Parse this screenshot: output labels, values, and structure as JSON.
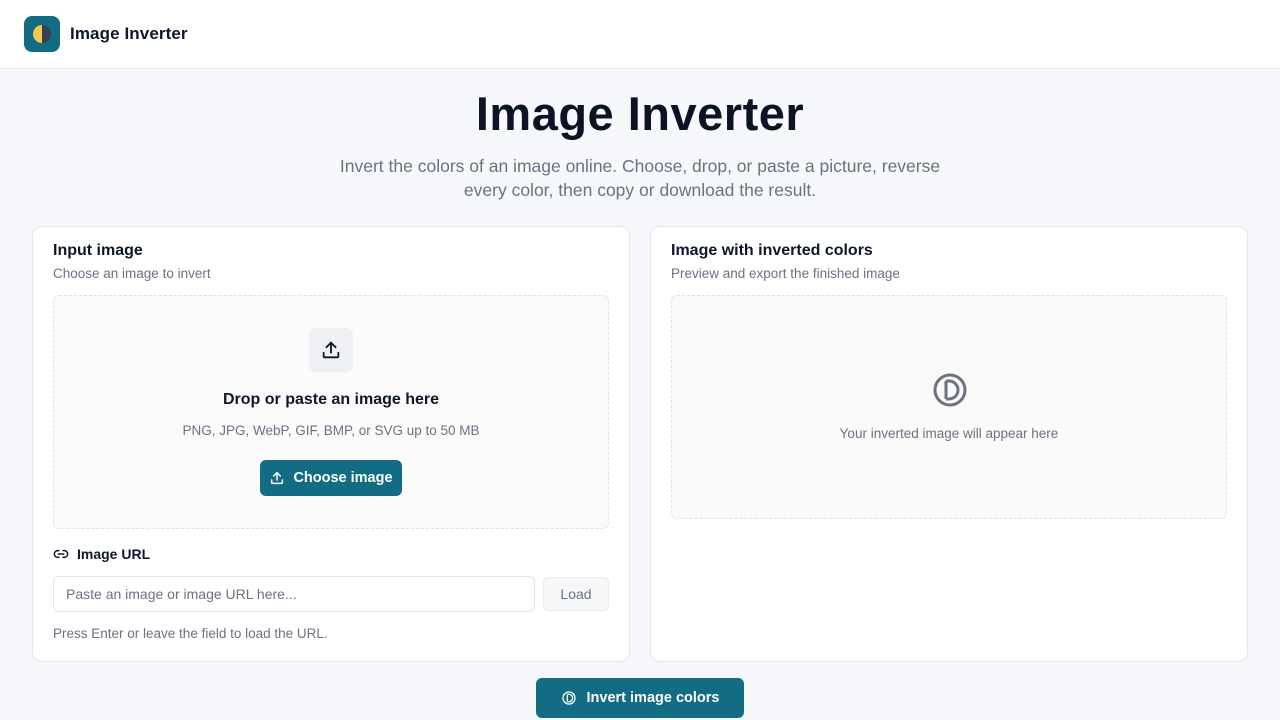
{
  "header": {
    "brand": "Image Inverter",
    "logo_icon": "half-moon-logo-icon"
  },
  "hero": {
    "title": "Image Inverter",
    "subtitle": "Invert the colors of an image online. Choose, drop, or paste a picture, reverse every color, then copy or download the result."
  },
  "input_card": {
    "title": "Input image",
    "subtitle": "Choose an image to invert",
    "dropzone": {
      "icon": "upload-icon",
      "title": "Drop or paste an image here",
      "hint": "PNG, JPG, WebP, GIF, BMP, or SVG up to 50 MB",
      "button_label": "Choose image"
    },
    "url": {
      "label": "Image URL",
      "icon": "link-icon",
      "placeholder": "Paste an image or image URL here...",
      "value": "",
      "load_label": "Load",
      "help": "Press Enter or leave the field to load the URL."
    }
  },
  "output_card": {
    "title": "Image with inverted colors",
    "subtitle": "Preview and export the finished image",
    "empty_icon": "contrast-icon",
    "empty_text": "Your inverted image will appear here"
  },
  "action": {
    "invert_label": "Invert image colors",
    "icon": "contrast-icon"
  },
  "colors": {
    "accent": "#126d84",
    "logo_yellow": "#f2c94c",
    "background": "#f7f8fb",
    "muted_text": "#6b7280"
  }
}
